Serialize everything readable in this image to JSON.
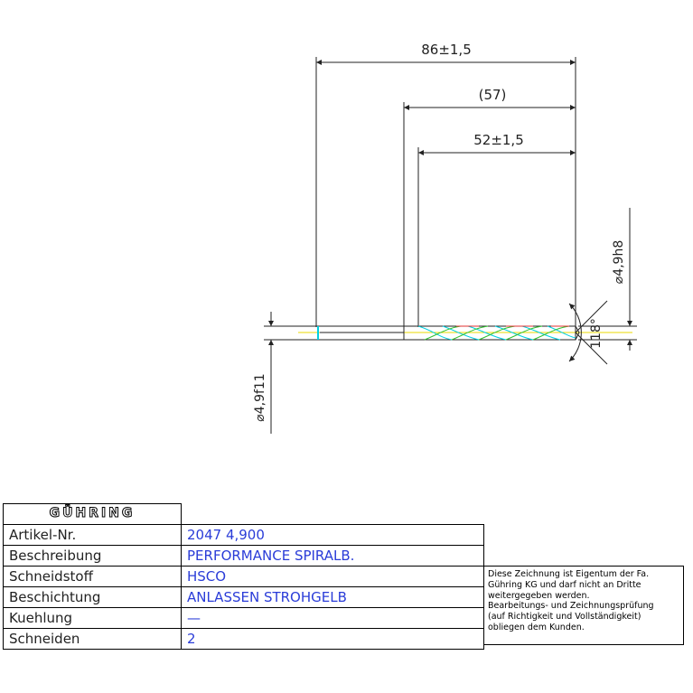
{
  "dimensions": {
    "overall_length": "86±1,5",
    "reference_length": "(57)",
    "flute_length": "52±1,5",
    "shank_diameter": "⌀4,9h8",
    "body_diameter": "⌀4,9f11",
    "point_angle": "118°"
  },
  "info_table": {
    "brand": "GÜHRING",
    "rows": [
      {
        "label": "Artikel-Nr.",
        "value": "2047 4,900"
      },
      {
        "label": "Beschreibung",
        "value": "PERFORMANCE SPIRALB."
      },
      {
        "label": "Schneidstoff",
        "value": "HSCO"
      },
      {
        "label": "Beschichtung",
        "value": "ANLASSEN STROHGELB"
      },
      {
        "label": "Kuehlung",
        "value": "—"
      },
      {
        "label": "Schneiden",
        "value": "2"
      }
    ]
  },
  "notice_lines": [
    "Diese Zeichnung ist Eigentum der Fa.",
    "Gühring KG und darf nicht an Dritte",
    "weitergegeben werden.",
    "Bearbeitungs- und Zeichnungsprüfung",
    "(auf Richtigkeit und Vollständigkeit)",
    "obliegen dem Kunden."
  ],
  "colors": {
    "line": "#222222",
    "value_text": "#2a3cd8",
    "flute_cyan": "#00cfe0",
    "flute_yellow": "#e8d800",
    "flute_red": "#e03030",
    "flute_green": "#30c030"
  }
}
